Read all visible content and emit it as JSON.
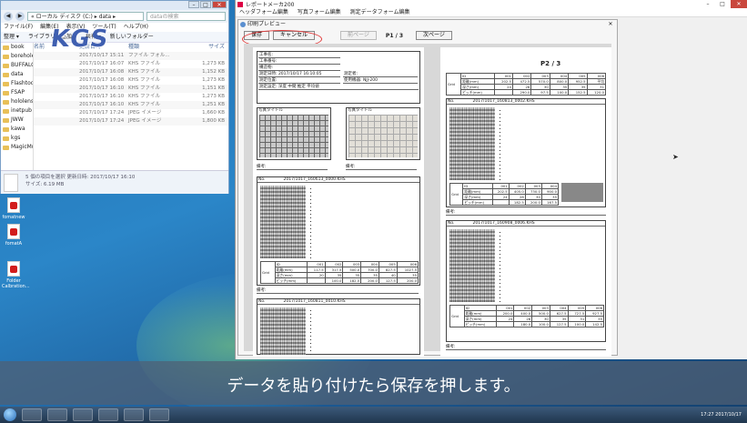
{
  "explorer": {
    "address": "« ローカル ディスク (C:) ▸ data ▸",
    "search_placeholder": "dataの検索",
    "menu": [
      "ファイル(F)",
      "編集(E)",
      "表示(V)",
      "ツール(T)",
      "ヘルプ(H)"
    ],
    "toolbar": [
      "整理 ▾",
      "ライブラリに追加 ▾",
      "共有 ▾",
      "新しいフォルダー"
    ],
    "tree": [
      "book",
      "borehole",
      "BUFFALO",
      "data",
      "Flashtool",
      "FSAP",
      "hololens",
      "inetpub",
      "JWW",
      "kawa",
      "kgs",
      "MagicMusMini"
    ],
    "columns": [
      "名前",
      "更新日時",
      "種類",
      "サイズ"
    ],
    "files": [
      {
        "date": "2017/10/17 15:11",
        "type": "ファイル フォル...",
        "size": ""
      },
      {
        "date": "2017/10/17 16:07",
        "type": "KHS ファイル",
        "size": "1,273 KB"
      },
      {
        "date": "2017/10/17 16:08",
        "type": "KHS ファイル",
        "size": "1,152 KB"
      },
      {
        "date": "2017/10/17 16:08",
        "type": "KHS ファイル",
        "size": "1,273 KB"
      },
      {
        "date": "2017/10/17 16:10",
        "type": "KHS ファイル",
        "size": "1,151 KB"
      },
      {
        "date": "2017/10/17 16:10",
        "type": "KHS ファイル",
        "size": "1,273 KB"
      },
      {
        "date": "2017/10/17 16:10",
        "type": "KHS ファイル",
        "size": "1,251 KB"
      },
      {
        "date": "2017/10/17 17:24",
        "type": "JPEG イメージ",
        "size": "1,660 KB"
      },
      {
        "date": "2017/10/17 17:24",
        "type": "JPEG イメージ",
        "size": "1,800 KB"
      }
    ],
    "status_line1": "5 個の項目を選択  更新日時: 2017/10/17 16:10",
    "status_line2": "サイズ: 6.19 MB"
  },
  "logo_text": "KGS",
  "desktop_icons": [
    "fomatnew",
    "fomatA",
    "Folder Calbration..."
  ],
  "app": {
    "title": "レポートメーカ200",
    "menu": [
      "ヘッダフォーム編集",
      "写真フォーム編集",
      "測定データフォーム編集"
    ]
  },
  "preview": {
    "title": "印刷プレビュー",
    "save_label": "保存",
    "close_label": "キャンセル",
    "prev_label": "前ページ",
    "next_label": "次ページ",
    "page_left": "P1 / 3",
    "page_right": "P2 / 3"
  },
  "page1": {
    "header_fields": [
      "工事名:",
      "工事番号:",
      "構造物:",
      "測定日時: 2017/10/17 16:10:05",
      "測定位置:",
      "測定設定: 深度 中間 推定 平均値",
      "測定者:",
      "使用機器: NJJ-200"
    ],
    "photo_labels": [
      "写真タイトル",
      "写真タイトル"
    ],
    "note_label": "備考:",
    "scan1_title": "2017/1017_160613_0000.KHS",
    "scan2_title": "2017/1017_160811_0010.KHS",
    "scan_no": "No.",
    "table_rows": [
      [
        "ID",
        "001",
        "002",
        "003",
        "004",
        "005",
        "006"
      ],
      [
        "距離(mm)",
        "117.5",
        "317.5",
        "500.0",
        "700.0",
        "827.5",
        "1027.5"
      ],
      [
        "深さ(mm)",
        "20",
        "35",
        "35",
        "35",
        "40",
        "35"
      ],
      [
        "ピッチ(mm)",
        "",
        "100.0",
        "182.5",
        "200.0",
        "127.5",
        "200.0"
      ]
    ],
    "table_side": "Grid"
  },
  "page2": {
    "scan_titles": [
      "2017/1017_160813_0002.KHS",
      "2017/1017_160908_0006.KHS"
    ],
    "table_rows_top": [
      [
        "ID",
        "001",
        "002",
        "003",
        "004",
        "005",
        "006"
      ],
      [
        "距離(mm)",
        "202.5",
        "472.5",
        "570.0",
        "800.0",
        "952.5",
        "平均"
      ],
      [
        "深さ(mm)",
        "24",
        "28",
        "30",
        "35",
        "35",
        "31"
      ],
      [
        "ピッチ(mm)",
        "",
        "290.0",
        "97.5",
        "100.0",
        "152.5",
        "120.0"
      ]
    ],
    "table_rows_mid": [
      [
        "ID",
        "001",
        "002",
        "003",
        "004"
      ],
      [
        "距離(mm)",
        "202.5",
        "405.0",
        "730.0",
        "900.0"
      ],
      [
        "深さ(mm)",
        "24",
        "28",
        "30",
        "35"
      ],
      [
        "ピッチ(mm)",
        "",
        "182.5",
        "200.0",
        "167.5"
      ]
    ],
    "table_rows_bottom": [
      [
        "ID",
        "001",
        "002",
        "003",
        "004",
        "005",
        "006"
      ],
      [
        "距離(mm)",
        "200.0",
        "400.0",
        "500.0",
        "627.5",
        "727.5",
        "927.5"
      ],
      [
        "深さ(mm)",
        "24",
        "28",
        "30",
        "35",
        "31",
        "35"
      ],
      [
        "ピッチ(mm)",
        "",
        "180.0",
        "100.0",
        "127.5",
        "100.0",
        "142.5"
      ]
    ],
    "table_side": "Grid",
    "note_label": "備考:"
  },
  "caption": "データを貼り付けたら保存を押します。",
  "clock": "17:27\n2017/10/17"
}
